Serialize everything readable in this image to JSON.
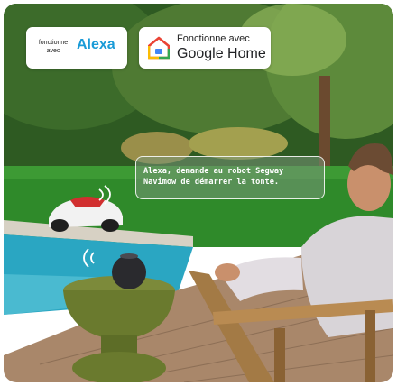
{
  "badges": {
    "alexa": {
      "prefix": "fonctionne avec",
      "brand": "Alexa",
      "brand_color": "#1a9bd7"
    },
    "google_home": {
      "prefix": "Fonctionne avec",
      "brand": "Google Home",
      "icon": "google-home-icon"
    }
  },
  "speech_bubble": {
    "text": "Alexa, demande au robot Segway Navimow de démarrer la tonte."
  },
  "colors": {
    "lawn": "#2f8a2a",
    "hedge": "#2e5a22",
    "pool_water": "#2aa6c2",
    "deck_wood": "#a9876a",
    "speaker_stand": "#7c8a3a"
  }
}
